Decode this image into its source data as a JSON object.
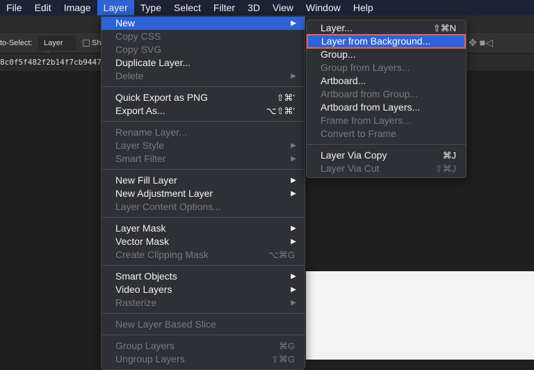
{
  "menubar": [
    "File",
    "Edit",
    "Image",
    "Layer",
    "Type",
    "Select",
    "Filter",
    "3D",
    "View",
    "Window",
    "Help"
  ],
  "options": {
    "auto_select_label": "to-Select:",
    "auto_select_value": "Layer",
    "show_label": "Sh"
  },
  "document_tab": "8c0f5f482f2b14f7cb9447",
  "layer_menu": [
    {
      "label": "New",
      "arrow": true,
      "highlighted": true
    },
    {
      "label": "Copy CSS",
      "disabled": true
    },
    {
      "label": "Copy SVG",
      "disabled": true
    },
    {
      "label": "Duplicate Layer..."
    },
    {
      "label": "Delete",
      "disabled": true,
      "arrow": true
    },
    {
      "sep": true
    },
    {
      "label": "Quick Export as PNG",
      "shortcut": "⇧⌘'"
    },
    {
      "label": "Export As...",
      "shortcut": "⌥⇧⌘'"
    },
    {
      "sep": true
    },
    {
      "label": "Rename Layer...",
      "disabled": true
    },
    {
      "label": "Layer Style",
      "disabled": true,
      "arrow": true
    },
    {
      "label": "Smart Filter",
      "disabled": true,
      "arrow": true
    },
    {
      "sep": true
    },
    {
      "label": "New Fill Layer",
      "arrow": true
    },
    {
      "label": "New Adjustment Layer",
      "arrow": true
    },
    {
      "label": "Layer Content Options...",
      "disabled": true
    },
    {
      "sep": true
    },
    {
      "label": "Layer Mask",
      "arrow": true
    },
    {
      "label": "Vector Mask",
      "arrow": true
    },
    {
      "label": "Create Clipping Mask",
      "disabled": true,
      "shortcut": "⌥⌘G"
    },
    {
      "sep": true
    },
    {
      "label": "Smart Objects",
      "arrow": true
    },
    {
      "label": "Video Layers",
      "arrow": true
    },
    {
      "label": "Rasterize",
      "disabled": true,
      "arrow": true
    },
    {
      "sep": true
    },
    {
      "label": "New Layer Based Slice",
      "disabled": true
    },
    {
      "sep": true
    },
    {
      "label": "Group Layers",
      "disabled": true,
      "shortcut": "⌘G"
    },
    {
      "label": "Ungroup Layers",
      "disabled": true,
      "shortcut": "⇧⌘G"
    }
  ],
  "new_submenu": [
    {
      "label": "Layer...",
      "shortcut": "⇧⌘N"
    },
    {
      "label": "Layer from Background...",
      "highlighted": true,
      "boxed": true
    },
    {
      "label": "Group..."
    },
    {
      "label": "Group from Layers...",
      "disabled": true
    },
    {
      "label": "Artboard..."
    },
    {
      "label": "Artboard from Group...",
      "disabled": true
    },
    {
      "label": "Artboard from Layers..."
    },
    {
      "label": "Frame from Layers...",
      "disabled": true
    },
    {
      "label": "Convert to Frame",
      "disabled": true
    },
    {
      "sep": true
    },
    {
      "label": "Layer Via Copy",
      "shortcut": "⌘J"
    },
    {
      "label": "Layer Via Cut",
      "disabled": true,
      "shortcut": "⇧⌘J"
    }
  ],
  "colors": {
    "highlight": "#2d63d6",
    "callout_box": "#e7625f",
    "menubar": "#1d2236"
  }
}
